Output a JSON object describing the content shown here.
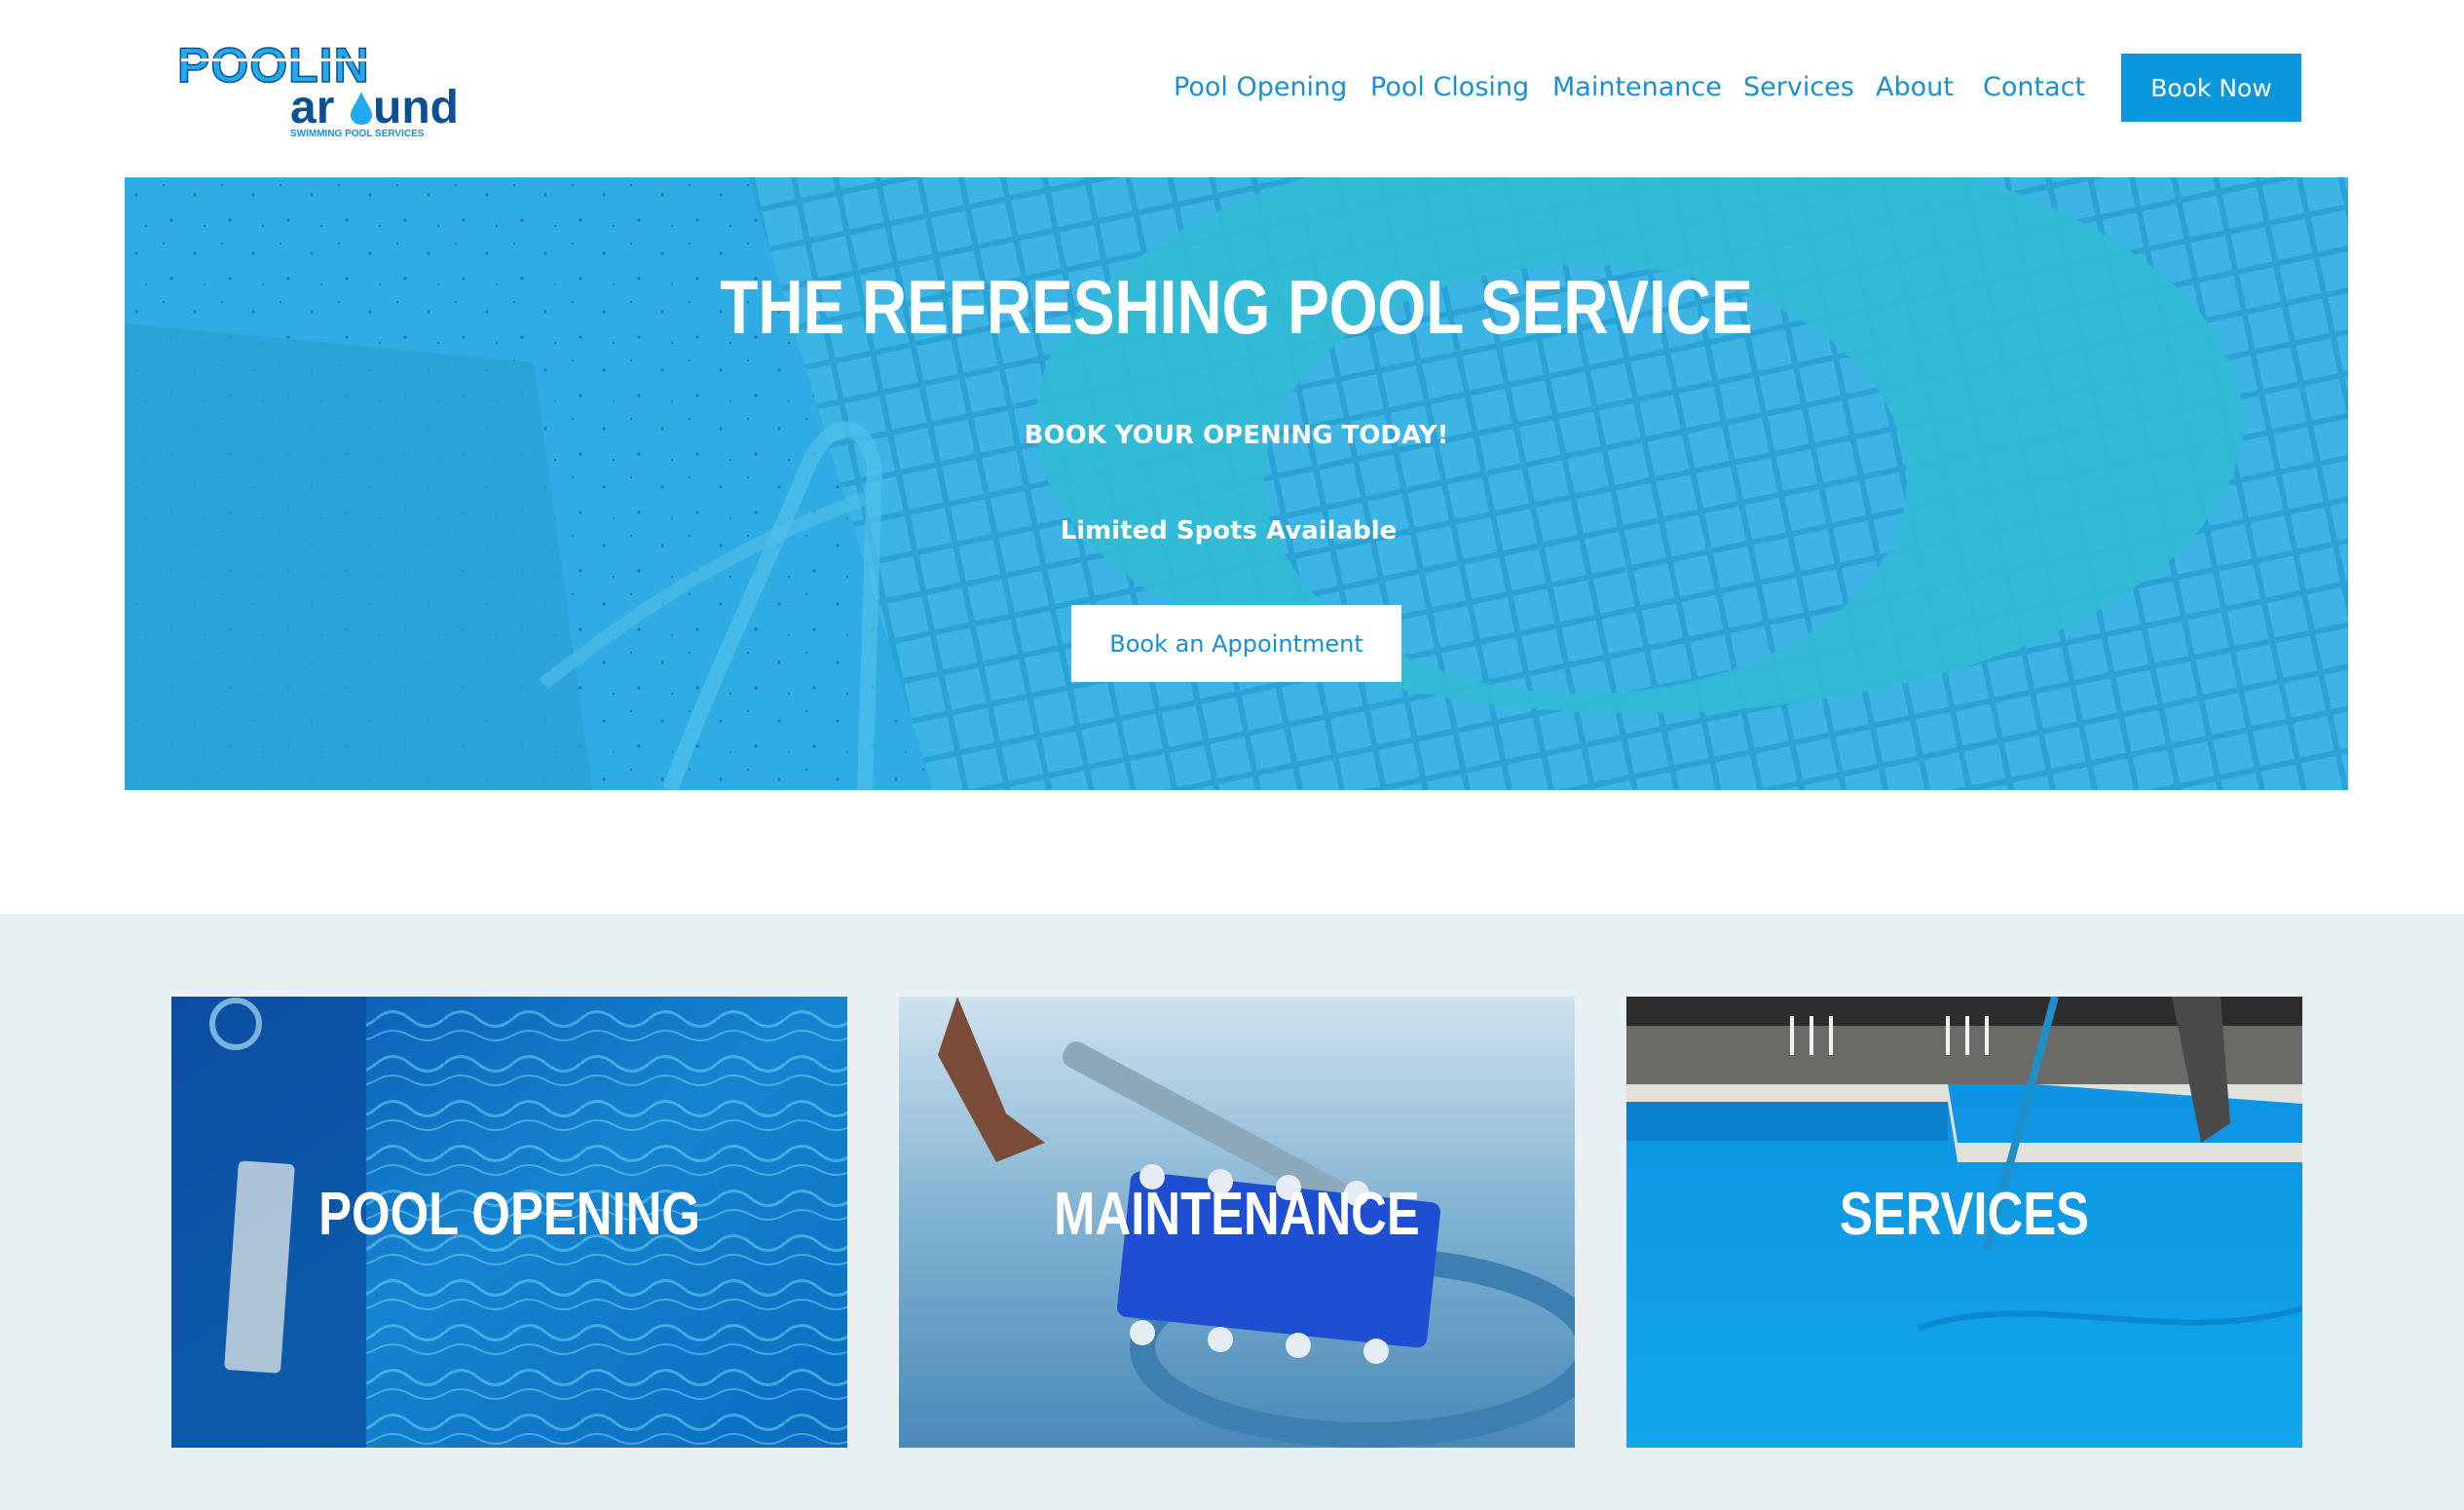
{
  "brand": {
    "logo_word1": "POOLIN",
    "logo_word2": "ar",
    "logo_word3": "und",
    "logo_tagline": "SWIMMING POOL SERVICES"
  },
  "nav": {
    "items": [
      "Pool Opening",
      "Pool Closing",
      "Maintenance",
      "Services",
      "About",
      "Contact"
    ],
    "cta": "Book Now"
  },
  "hero": {
    "title": "THE REFRESHING POOL SERVICE",
    "subtitle": "BOOK YOUR OPENING TODAY!",
    "note": "Limited Spots Available",
    "button": "Book an Appointment"
  },
  "cards": [
    {
      "label": "POOL OPENING"
    },
    {
      "label": "MAINTENANCE"
    },
    {
      "label": "SERVICES"
    }
  ],
  "colors": {
    "accent": "#0b97dd",
    "nav_text": "#1a8fd0",
    "hero_overlay": "#28a9e0",
    "band_bg": "#e9f0f4",
    "logo_dark": "#0d4f93"
  }
}
